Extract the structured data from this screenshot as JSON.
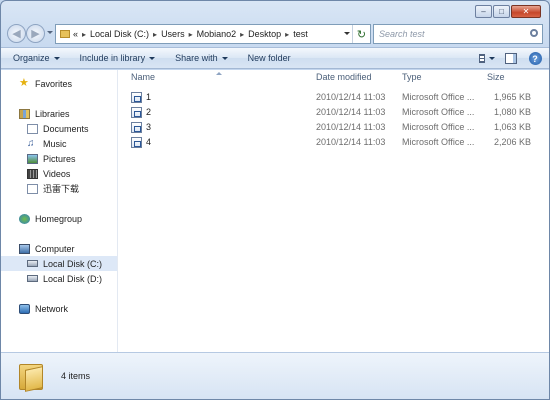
{
  "caption": {
    "minimize": "–",
    "maximize": "□",
    "close": "✕"
  },
  "address": {
    "overflow": "«",
    "crumbs": [
      "Local Disk (C:)",
      "Users",
      "Mobiano2",
      "Desktop",
      "test"
    ],
    "search_placeholder": "Search test"
  },
  "toolbar": {
    "organize": "Organize",
    "include_in_library": "Include in library",
    "share_with": "Share with",
    "new_folder": "New folder"
  },
  "nav": {
    "favorites": "Favorites",
    "libraries": "Libraries",
    "documents": "Documents",
    "music": "Music",
    "pictures": "Pictures",
    "videos": "Videos",
    "xunlei": "迅雷下载",
    "homegroup": "Homegroup",
    "computer": "Computer",
    "local_c": "Local Disk (C:)",
    "local_d": "Local Disk (D:)",
    "network": "Network"
  },
  "columns": {
    "name": "Name",
    "date": "Date modified",
    "type": "Type",
    "size": "Size"
  },
  "files": [
    {
      "name": "1",
      "date": "2010/12/14 11:03",
      "type": "Microsoft Office ...",
      "size": "1,965 KB"
    },
    {
      "name": "2",
      "date": "2010/12/14 11:03",
      "type": "Microsoft Office ...",
      "size": "1,080 KB"
    },
    {
      "name": "3",
      "date": "2010/12/14 11:03",
      "type": "Microsoft Office ...",
      "size": "1,063 KB"
    },
    {
      "name": "4",
      "date": "2010/12/14 11:03",
      "type": "Microsoft Office ...",
      "size": "2,206 KB"
    }
  ],
  "details": {
    "item_count": "4 items"
  }
}
